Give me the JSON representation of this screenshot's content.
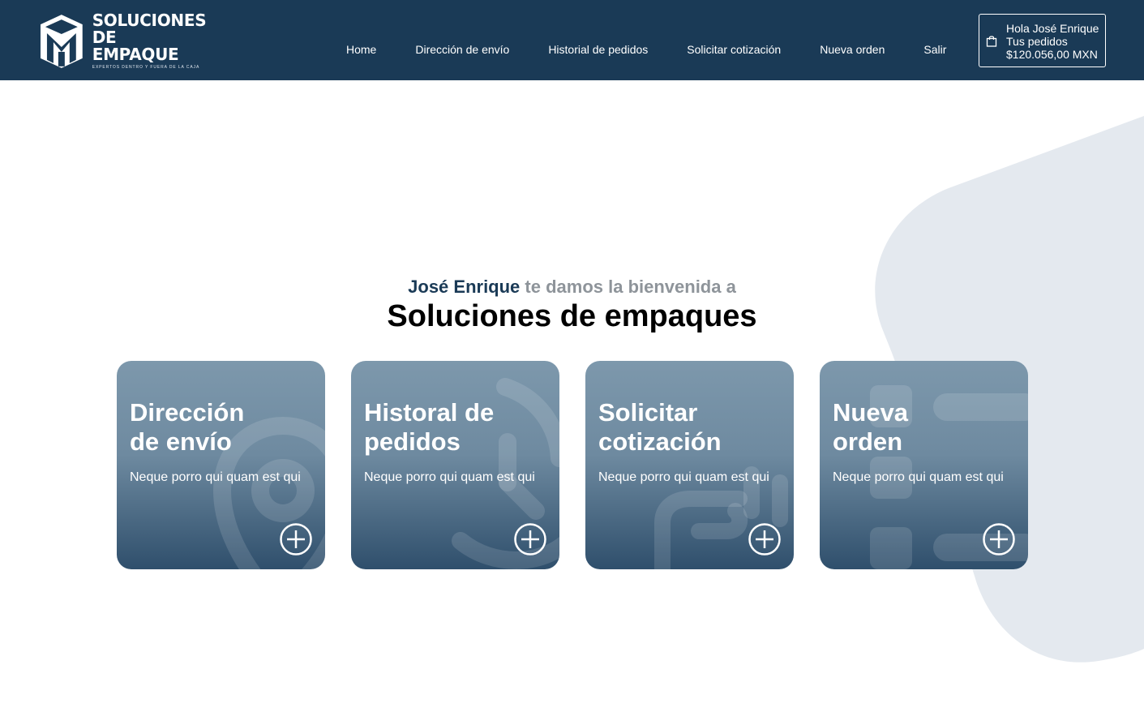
{
  "logo": {
    "line1": "SOLUCIONES",
    "line2": "DE EMPAQUE",
    "tagline": "EXPERTOS DENTRO Y FUERA DE LA CAJA"
  },
  "nav": [
    {
      "label": "Home"
    },
    {
      "label": "Dirección de envío"
    },
    {
      "label": "Historial de pedidos"
    },
    {
      "label": "Solicitar cotización"
    },
    {
      "label": "Nueva orden"
    },
    {
      "label": "Salir"
    }
  ],
  "cart": {
    "icon": "shopping-bag-icon",
    "greeting": "Hola José Enrique",
    "orders_label": "Tus pedidos",
    "total": "$120.056,00 MXN"
  },
  "welcome": {
    "user": "José Enrique",
    "text": " te damos la bienvenida a",
    "title": "Soluciones de empaques"
  },
  "cards": [
    {
      "title_line1": "Dirección",
      "title_line2": "de envío",
      "desc": "Neque porro qui quam est qui",
      "icon": "location-pin-icon"
    },
    {
      "title_line1": "Historal de",
      "title_line2": "pedidos",
      "desc": "Neque porro qui quam est qui",
      "icon": "clock-history-icon"
    },
    {
      "title_line1": "Solicitar",
      "title_line2": "cotización",
      "desc": "Neque porro qui quam est qui",
      "icon": "hand-coins-icon"
    },
    {
      "title_line1": "Nueva",
      "title_line2": "orden",
      "desc": "Neque porro qui quam est qui",
      "icon": "list-icon"
    }
  ],
  "colors": {
    "header": "#1a3a56",
    "accent_name": "#1a3a56",
    "welcome_text": "#8e949a",
    "bg_blob": "#e4e9ef"
  }
}
